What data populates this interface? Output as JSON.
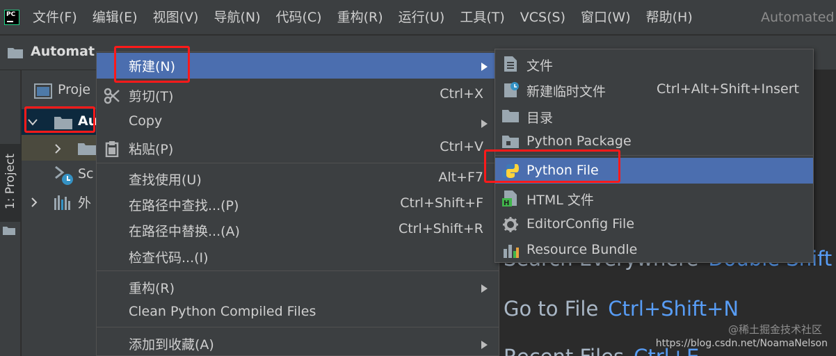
{
  "app": {
    "logo_text": "PC",
    "window_title": "Automated"
  },
  "menubar": {
    "items": [
      "文件(F)",
      "编辑(E)",
      "视图(V)",
      "导航(N)",
      "代码(C)",
      "重构(R)",
      "运行(U)",
      "工具(T)",
      "VCS(S)",
      "窗口(W)",
      "帮助(H)"
    ]
  },
  "navbar": {
    "project": "Automat"
  },
  "toolstrip": {
    "tab_label": "1: Project"
  },
  "tree": {
    "header": "Proje",
    "root": "Au",
    "scratches": "Sc",
    "external": "外"
  },
  "context_menu": {
    "items": [
      {
        "label": "新建(N)",
        "shortcut": "",
        "submenu": true,
        "icon": "none"
      },
      {
        "label": "剪切(T)",
        "shortcut": "Ctrl+X",
        "submenu": false,
        "icon": "scissors-icon"
      },
      {
        "label": "Copy",
        "shortcut": "",
        "submenu": true,
        "icon": "none"
      },
      {
        "label": "粘贴(P)",
        "shortcut": "Ctrl+V",
        "submenu": false,
        "icon": "clipboard-icon"
      },
      {
        "label": "查找使用(U)",
        "shortcut": "Alt+F7",
        "submenu": false,
        "icon": "none"
      },
      {
        "label": "在路径中查找...(P)",
        "shortcut": "Ctrl+Shift+F",
        "submenu": false,
        "icon": "none"
      },
      {
        "label": "在路径中替换...(A)",
        "shortcut": "Ctrl+Shift+R",
        "submenu": false,
        "icon": "none"
      },
      {
        "label": "检查代码...(I)",
        "shortcut": "",
        "submenu": false,
        "icon": "none"
      },
      {
        "label": "重构(R)",
        "shortcut": "",
        "submenu": true,
        "icon": "none"
      },
      {
        "label": "Clean Python Compiled Files",
        "shortcut": "",
        "submenu": false,
        "icon": "none"
      },
      {
        "label": "添加到收藏(A)",
        "shortcut": "",
        "submenu": true,
        "icon": "none"
      }
    ]
  },
  "submenu": {
    "items": [
      {
        "label": "文件",
        "shortcut": "",
        "icon": "file-icon"
      },
      {
        "label": "新建临时文件",
        "shortcut": "Ctrl+Alt+Shift+Insert",
        "icon": "scratch-file-icon"
      },
      {
        "label": "目录",
        "shortcut": "",
        "icon": "folder-icon"
      },
      {
        "label": "Python Package",
        "shortcut": "",
        "icon": "package-icon"
      },
      {
        "label": "Python File",
        "shortcut": "",
        "icon": "python-icon"
      },
      {
        "label": "HTML 文件",
        "shortcut": "",
        "icon": "html-icon"
      },
      {
        "label": "EditorConfig File",
        "shortcut": "",
        "icon": "gear-icon"
      },
      {
        "label": "Resource Bundle",
        "shortcut": "",
        "icon": "resource-bundle-icon"
      }
    ]
  },
  "welcome": {
    "search_label": "Search Everywhere",
    "search_key": "Double Shift",
    "goto_label": "Go to File",
    "goto_key": "Ctrl+Shift+N",
    "recent_label": "Recent Files",
    "recent_key": "Ctrl+E"
  },
  "watermark": {
    "url": "https://blog.csdn.net/NoamaNelson",
    "site": "@稀土掘金技术社区"
  },
  "colors": {
    "highlight": "#4b6eaf",
    "annotation": "#ff1a1a",
    "shortcut_blue": "#589df6"
  }
}
